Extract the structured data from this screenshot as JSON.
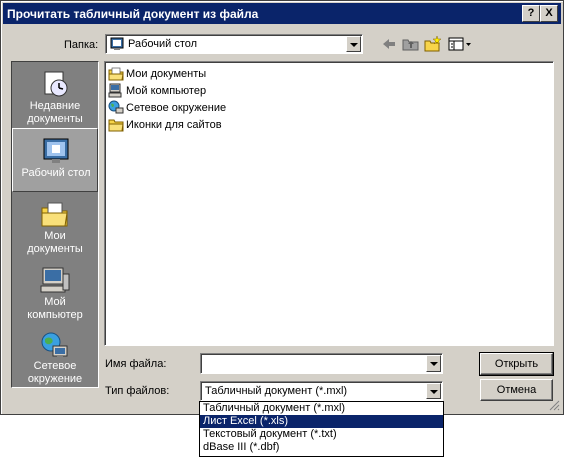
{
  "window": {
    "title": "Прочитать табличный документ из файла",
    "help_label": "?",
    "close_label": "X"
  },
  "lookin": {
    "label": "Папка:",
    "value": "Рабочий стол"
  },
  "places": [
    {
      "label_line1": "Недавние",
      "label_line2": "документы",
      "icon": "recent-documents-icon"
    },
    {
      "label_line1": "Рабочий стол",
      "label_line2": "",
      "icon": "desktop-icon"
    },
    {
      "label_line1": "Мои",
      "label_line2": "документы",
      "icon": "my-documents-icon"
    },
    {
      "label_line1": "Мой",
      "label_line2": "компьютер",
      "icon": "my-computer-icon"
    },
    {
      "label_line1": "Сетевое",
      "label_line2": "окружение",
      "icon": "network-icon"
    }
  ],
  "files": [
    {
      "name": "Мои документы",
      "icon": "folder-documents-icon"
    },
    {
      "name": "Мой компьютер",
      "icon": "computer-icon"
    },
    {
      "name": "Сетевое окружение",
      "icon": "network-icon"
    },
    {
      "name": "Иконки для сайтов",
      "icon": "folder-icon"
    }
  ],
  "filename": {
    "label": "Имя файла:",
    "value": ""
  },
  "filetype": {
    "label": "Тип файлов:",
    "value": "Табличный документ (*.mxl)",
    "options": [
      "Табличный документ (*.mxl)",
      "Лист Excel (*.xls)",
      "Текстовый документ (*.txt)",
      "dBase III (*.dbf)"
    ],
    "highlighted_index": 1
  },
  "buttons": {
    "open": "Открыть",
    "cancel": "Отмена"
  },
  "colors": {
    "titlebar": "#0a246a",
    "face": "#d4d0c8",
    "places_bar": "#808080",
    "selection": "#0a246a"
  }
}
